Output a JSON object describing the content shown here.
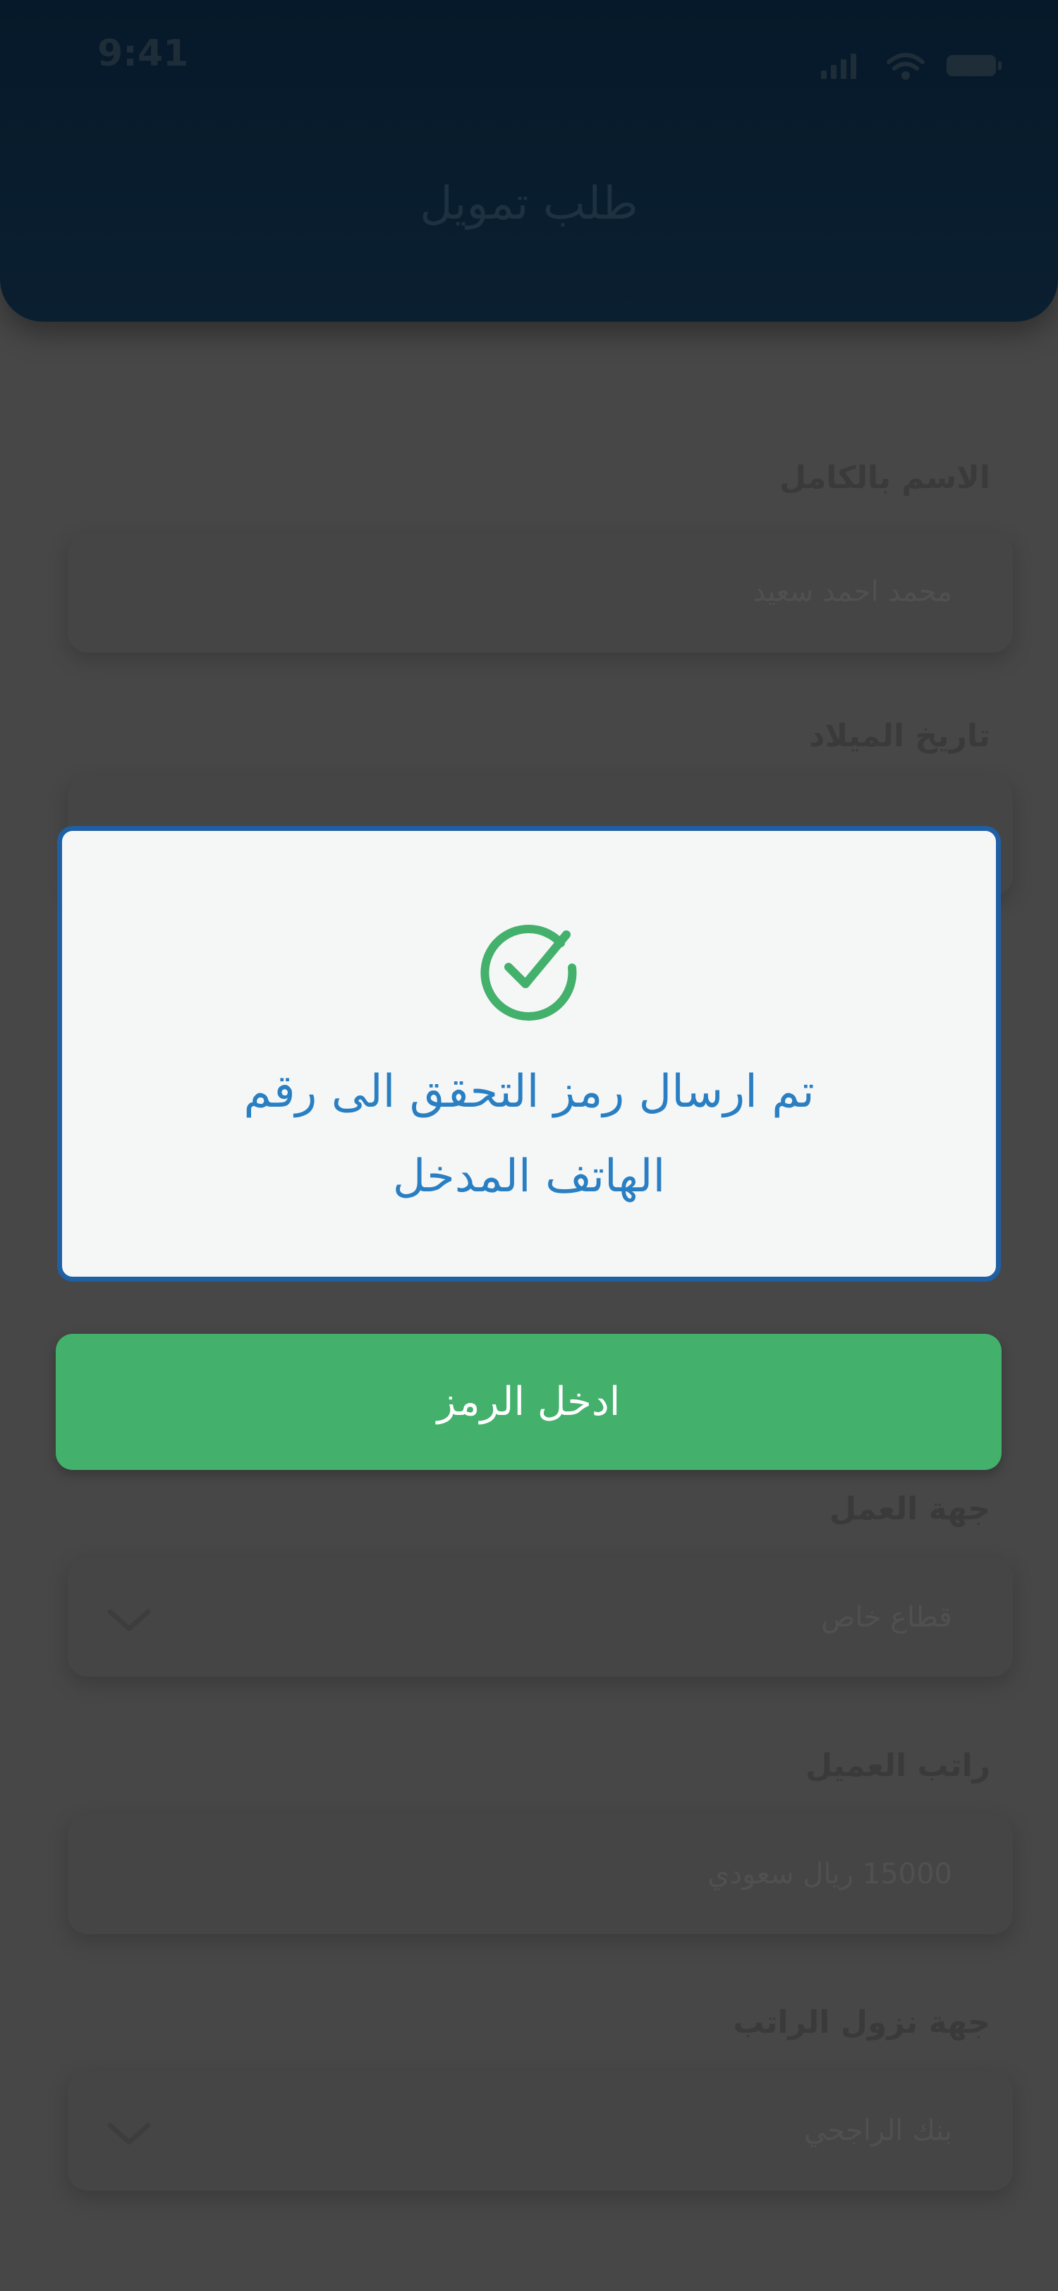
{
  "status_bar": {
    "time": "9:41",
    "icons": [
      "signal-icon",
      "wifi-icon",
      "battery-icon"
    ]
  },
  "header": {
    "title": "طلب تمويل"
  },
  "form": {
    "fields": [
      {
        "label": "الاسم بالكامل",
        "placeholder": "محمد احمد سعيد"
      },
      {
        "label": "تاريخ الميلاد",
        "placeholder": ""
      },
      {
        "label": "جهة العمل",
        "placeholder": "قطاع خاص"
      },
      {
        "label": "راتب العميل",
        "placeholder": "15000 ريال سعودي"
      },
      {
        "label": "جهة نزول الراتب",
        "placeholder": "بنك الراجحي"
      }
    ]
  },
  "dialog": {
    "icon": "check-circle-icon",
    "message_line1": "تم ارسال رمز التحقق الى رقم",
    "message_line2": "الهاتف المدخل"
  },
  "actions": {
    "enter_code_label": "ادخل الرمز"
  },
  "colors": {
    "overlay_background": "#474747",
    "dialog_border": "#1f5fa3",
    "dialog_text": "#2a7fc3",
    "success_green": "#43b06b"
  }
}
